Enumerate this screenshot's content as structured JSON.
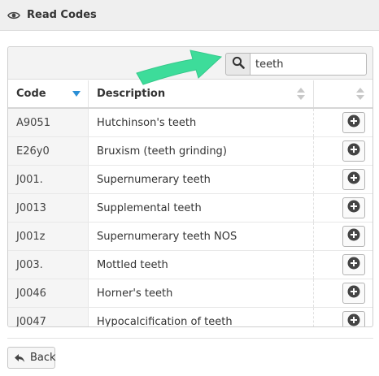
{
  "header": {
    "title": "Read Codes",
    "icon": "eye-icon"
  },
  "search": {
    "value": "teeth",
    "icon": "search-icon"
  },
  "table": {
    "columns": {
      "code": "Code",
      "description": "Description"
    },
    "rows": [
      {
        "code": "A9051",
        "description": "Hutchinson's teeth"
      },
      {
        "code": "E26y0",
        "description": "Bruxism (teeth grinding)"
      },
      {
        "code": "J001.",
        "description": "Supernumerary teeth"
      },
      {
        "code": "J0013",
        "description": "Supplemental teeth"
      },
      {
        "code": "J001z",
        "description": "Supernumerary teeth NOS"
      },
      {
        "code": "J003.",
        "description": "Mottled teeth"
      },
      {
        "code": "J0046",
        "description": "Horner's teeth"
      },
      {
        "code": "J0047",
        "description": "Hypocalcification of teeth"
      }
    ]
  },
  "footer": {
    "back_label": "Back",
    "back_icon": "reply-icon"
  },
  "colors": {
    "arrow": "#3ddc9a",
    "sort_active": "#2b8fd6",
    "add_icon": "#444444"
  }
}
